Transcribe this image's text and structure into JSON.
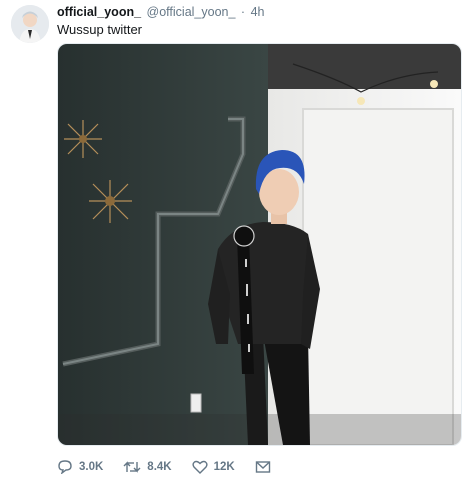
{
  "tweet": {
    "display_name": "official_yoon_",
    "handle": "@official_yoon_",
    "separator": "·",
    "time": "4h",
    "text": "Wussup twitter"
  },
  "actions": {
    "reply_count": "3.0K",
    "retweet_count": "8.4K",
    "like_count": "12K"
  },
  "icons": [
    "reply-icon",
    "retweet-icon",
    "like-icon",
    "message-icon"
  ],
  "colors": {
    "name": "#14171a",
    "secondary": "#657786",
    "photo_wall": "#2f3b3a",
    "hair": "#2a55b8"
  }
}
